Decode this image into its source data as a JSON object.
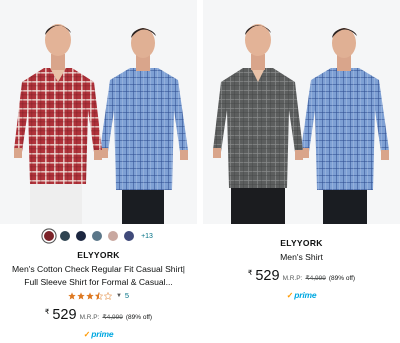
{
  "products": [
    {
      "brand": "ELYYORK",
      "title_lines": [
        "Men's Cotton Check Regular Fit Casual Shirt|",
        "Full Sleeve Shirt for Formal & Casual..."
      ],
      "swatches": [
        {
          "color": "#7b2329",
          "selected": true
        },
        {
          "color": "#2f4451",
          "selected": false
        },
        {
          "color": "#1c2640",
          "selected": false
        },
        {
          "color": "#5b7789",
          "selected": false
        },
        {
          "color": "#c9a8a0",
          "selected": false
        },
        {
          "color": "#404a7a",
          "selected": false
        }
      ],
      "more_colors": "+13",
      "rating": 3.5,
      "review_count": "5",
      "currency": "₹",
      "price": "529",
      "mrp_label": "M.R.P:",
      "mrp": "₹4,999",
      "discount": "(89% off)",
      "prime_label": "prime",
      "shirt_colors": {
        "front": "#b0323a",
        "back": "#7ea0d4"
      }
    },
    {
      "brand": "ELYYORK",
      "title_lines": [
        "Men's Shirt"
      ],
      "currency": "₹",
      "price": "529",
      "mrp_label": "M.R.P:",
      "mrp": "₹4,999",
      "discount": "(89% off)",
      "prime_label": "prime",
      "shirt_colors": {
        "front": "#5c5e5e",
        "back": "#7ea0d4"
      }
    }
  ],
  "icons": {
    "prime_check": "checkmark-icon",
    "star": "star-icon",
    "rating_dropdown": "chevron-down-icon"
  },
  "colors": {
    "link": "#007185",
    "prime": "#00a8e1",
    "star": "#de7921",
    "text": "#0f1111",
    "muted": "#565959"
  }
}
